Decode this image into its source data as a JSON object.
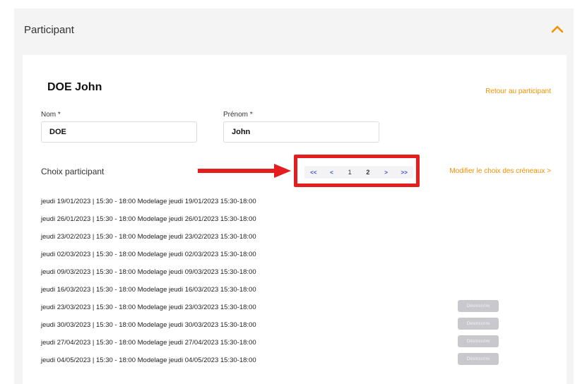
{
  "section": {
    "title": "Participant",
    "toggle_icon": "chevron-up-icon"
  },
  "participant": {
    "display_name": "DOE John",
    "back_link": "Retour au participant"
  },
  "form": {
    "nom_label": "Nom *",
    "nom_value": "DOE",
    "prenom_label": "Prénom *",
    "prenom_value": "John"
  },
  "choices": {
    "label": "Choix participant",
    "modify_link": "Modifier le choix des créneaux >"
  },
  "pagination": {
    "first": "<<",
    "prev": "<",
    "pages": [
      "1",
      "2"
    ],
    "next": ">",
    "last": ">>"
  },
  "slots": [
    {
      "text": "jeudi 19/01/2023 | 15:30 - 18:00 Modelage jeudi 19/01/2023 15:30-18:00",
      "button": ""
    },
    {
      "text": "jeudi 26/01/2023 | 15:30 - 18:00 Modelage jeudi 26/01/2023 15:30-18:00",
      "button": ""
    },
    {
      "text": "jeudi 23/02/2023 | 15:30 - 18:00 Modelage jeudi 23/02/2023 15:30-18:00",
      "button": ""
    },
    {
      "text": "jeudi 02/03/2023 | 15:30 - 18:00 Modelage jeudi 02/03/2023 15:30-18:00",
      "button": ""
    },
    {
      "text": "jeudi 09/03/2023 | 15:30 - 18:00 Modelage jeudi 09/03/2023 15:30-18:00",
      "button": ""
    },
    {
      "text": "jeudi 16/03/2023 | 15:30 - 18:00 Modelage jeudi 16/03/2023 15:30-18:00",
      "button": ""
    },
    {
      "text": "jeudi 23/03/2023 | 15:30 - 18:00 Modelage jeudi 23/03/2023 15:30-18:00",
      "button": "Désinscrire"
    },
    {
      "text": "jeudi 30/03/2023 | 15:30 - 18:00 Modelage jeudi 30/03/2023 15:30-18:00",
      "button": "Désinscrire"
    },
    {
      "text": "jeudi 27/04/2023 | 15:30 - 18:00 Modelage jeudi 27/04/2023 15:30-18:00",
      "button": "Désinscrire"
    },
    {
      "text": "jeudi 04/05/2023 | 15:30 - 18:00 Modelage jeudi 04/05/2023 15:30-18:00",
      "button": "Désinscrire"
    }
  ],
  "colors": {
    "accent": "#f29100",
    "annotation": "#e41e1e",
    "pager_link": "#3a4bd1",
    "disabled_button": "#c9c9cd"
  }
}
